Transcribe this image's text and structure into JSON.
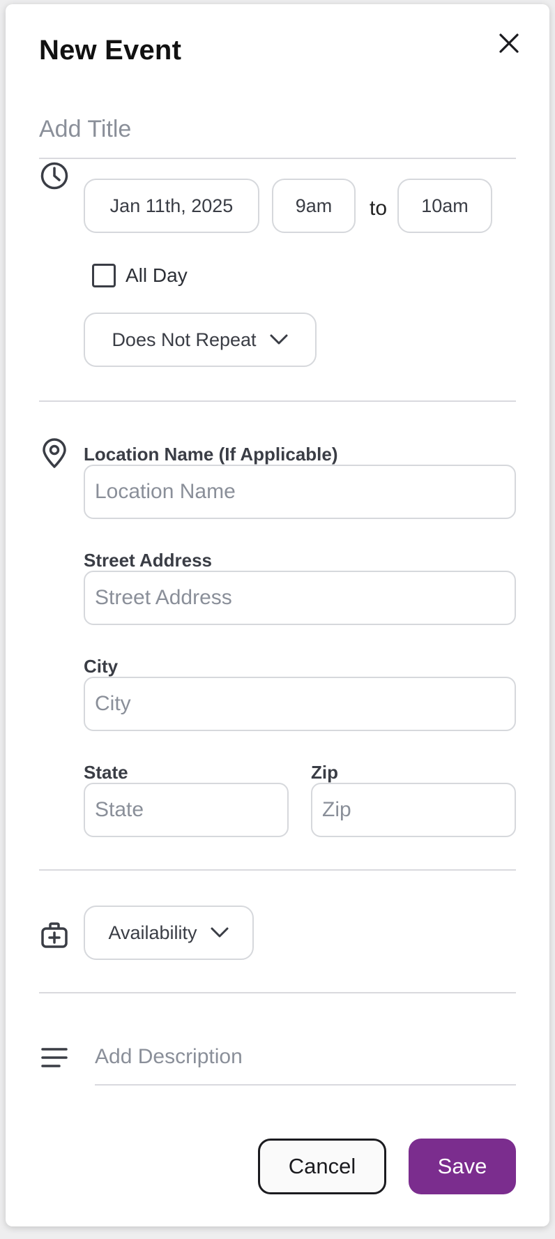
{
  "dialog": {
    "title": "New Event"
  },
  "event_title": {
    "placeholder": "Add Title"
  },
  "schedule": {
    "date": "Jan 11th, 2025",
    "start_time": "9am",
    "to_label": "to",
    "end_time": "10am",
    "all_day_label": "All Day",
    "all_day_checked": false,
    "repeat_value": "Does Not Repeat"
  },
  "location": {
    "name_label": "Location Name (If Applicable)",
    "name_placeholder": "Location Name",
    "street_label": "Street Address",
    "street_placeholder": "Street Address",
    "city_label": "City",
    "city_placeholder": "City",
    "state_label": "State",
    "state_placeholder": "State",
    "zip_label": "Zip",
    "zip_placeholder": "Zip"
  },
  "availability": {
    "value": "Availability"
  },
  "description": {
    "placeholder": "Add Description"
  },
  "actions": {
    "cancel_label": "Cancel",
    "save_label": "Save"
  },
  "icons": {
    "close": "close-icon",
    "time": "clock-icon",
    "location": "map-pin-icon",
    "availability": "briefcase-plus-icon",
    "description": "text-lines-icon",
    "dropdown": "chevron-down-icon"
  },
  "colors": {
    "primary": "#7b2d8e",
    "border": "#d6d8dc",
    "placeholder": "#8a8f99",
    "text_dark": "#111111"
  }
}
